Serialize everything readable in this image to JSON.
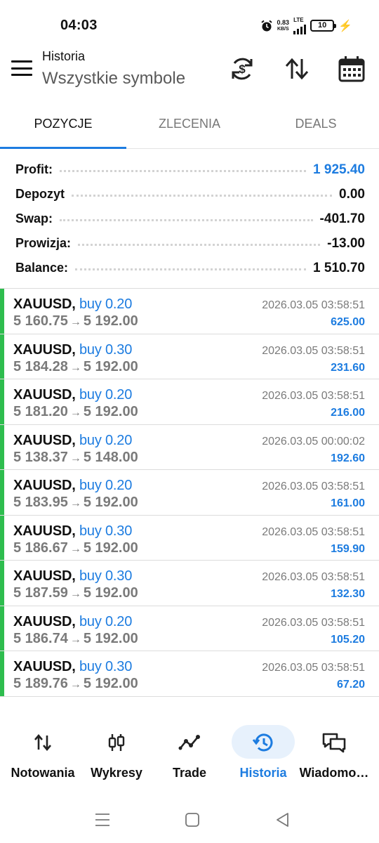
{
  "status_bar": {
    "time": "04:03",
    "net_speed": "0.83",
    "net_unit": "KB/S",
    "network": "LTE",
    "battery": "10"
  },
  "header": {
    "title": "Historia",
    "subtitle": "Wszystkie symbole",
    "icons": [
      "sync-currency-icon",
      "sort-icon",
      "calendar-icon"
    ]
  },
  "tabs": [
    {
      "label": "POZYCJE",
      "active": true
    },
    {
      "label": "ZLECENIA",
      "active": false
    },
    {
      "label": "DEALS",
      "active": false
    }
  ],
  "summary": [
    {
      "label": "Profit:",
      "value": "1 925.40",
      "highlight": true
    },
    {
      "label": "Depozyt",
      "value": "0.00",
      "highlight": false
    },
    {
      "label": "Swap:",
      "value": "-401.70",
      "highlight": false
    },
    {
      "label": "Prowizja:",
      "value": "-13.00",
      "highlight": false
    },
    {
      "label": "Balance:",
      "value": "1 510.70",
      "highlight": false
    }
  ],
  "positions": [
    {
      "symbol": "XAUUSD,",
      "side": "buy 0.20",
      "open": "5 160.75",
      "arrow": "→",
      "close": "5 192.00",
      "time": "2026.03.05 03:58:51",
      "profit": "625.00"
    },
    {
      "symbol": "XAUUSD,",
      "side": "buy 0.30",
      "open": "5 184.28",
      "arrow": "→",
      "close": "5 192.00",
      "time": "2026.03.05 03:58:51",
      "profit": "231.60"
    },
    {
      "symbol": "XAUUSD,",
      "side": "buy 0.20",
      "open": "5 181.20",
      "arrow": "→",
      "close": "5 192.00",
      "time": "2026.03.05 03:58:51",
      "profit": "216.00"
    },
    {
      "symbol": "XAUUSD,",
      "side": "buy 0.20",
      "open": "5 138.37",
      "arrow": "→",
      "close": "5 148.00",
      "time": "2026.03.05 00:00:02",
      "profit": "192.60"
    },
    {
      "symbol": "XAUUSD,",
      "side": "buy 0.20",
      "open": "5 183.95",
      "arrow": "→",
      "close": "5 192.00",
      "time": "2026.03.05 03:58:51",
      "profit": "161.00"
    },
    {
      "symbol": "XAUUSD,",
      "side": "buy 0.30",
      "open": "5 186.67",
      "arrow": "→",
      "close": "5 192.00",
      "time": "2026.03.05 03:58:51",
      "profit": "159.90"
    },
    {
      "symbol": "XAUUSD,",
      "side": "buy 0.30",
      "open": "5 187.59",
      "arrow": "→",
      "close": "5 192.00",
      "time": "2026.03.05 03:58:51",
      "profit": "132.30"
    },
    {
      "symbol": "XAUUSD,",
      "side": "buy 0.20",
      "open": "5 186.74",
      "arrow": "→",
      "close": "5 192.00",
      "time": "2026.03.05 03:58:51",
      "profit": "105.20"
    },
    {
      "symbol": "XAUUSD,",
      "side": "buy 0.30",
      "open": "5 189.76",
      "arrow": "→",
      "close": "5 192.00",
      "time": "2026.03.05 03:58:51",
      "profit": "67.20"
    }
  ],
  "bottom_nav": [
    {
      "label": "Notowania",
      "icon": "quotes-icon",
      "active": false
    },
    {
      "label": "Wykresy",
      "icon": "charts-icon",
      "active": false
    },
    {
      "label": "Trade",
      "icon": "trade-icon",
      "active": false
    },
    {
      "label": "Historia",
      "icon": "history-icon",
      "active": true
    },
    {
      "label": "Wiadomo…",
      "icon": "messages-icon",
      "active": false
    }
  ],
  "colors": {
    "accent": "#1d7ce0",
    "buy_marker": "#2ebd4e",
    "muted": "#7a7a7a"
  }
}
